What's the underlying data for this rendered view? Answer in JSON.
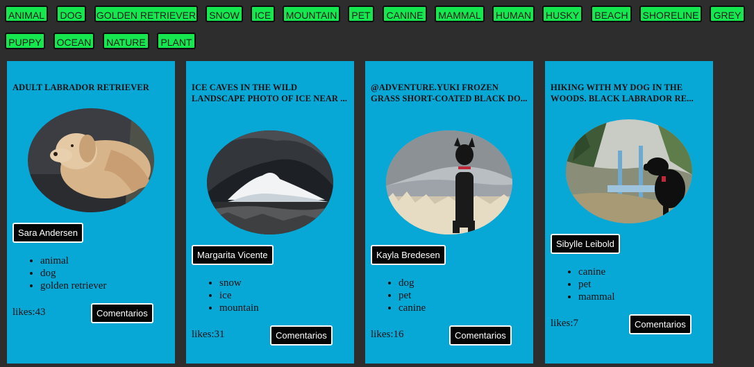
{
  "tags": [
    "ANIMAL",
    "DOG",
    "GOLDEN RETRIEVER",
    "SNOW",
    "ICE",
    "MOUNTAIN",
    "PET",
    "CANINE",
    "MAMMAL",
    "HUMAN",
    "HUSKY",
    "BEACH",
    "SHORELINE",
    "GREY",
    "PUPPY",
    "OCEAN",
    "NATURE",
    "PLANT"
  ],
  "cards": [
    {
      "title": "ADULT LABRADOR RETRIEVER",
      "author": "Sara Andersen",
      "tags": [
        "animal",
        "dog",
        "golden retriever"
      ],
      "likes": "likes:43",
      "comments_label": "Comentarios"
    },
    {
      "title": "ICE CAVES IN THE WILD LANDSCAPE PHOTO OF ICE NEAR ...",
      "author": "Margarita Vicente",
      "tags": [
        "snow",
        "ice",
        "mountain"
      ],
      "likes": "likes:31",
      "comments_label": "Comentarios"
    },
    {
      "title": "@ADVENTURE.YUKI FROZEN GRASS SHORT-COATED BLACK DO...",
      "author": "Kayla Bredesen",
      "tags": [
        "dog",
        "pet",
        "canine"
      ],
      "likes": "likes:16",
      "comments_label": "Comentarios"
    },
    {
      "title": "HIKING WITH MY DOG IN THE WOODS. BLACK LABRADOR RE...",
      "author": "Sibylle Leibold",
      "tags": [
        "canine",
        "pet",
        "mammal"
      ],
      "likes": "likes:7",
      "comments_label": "Comentarios"
    }
  ],
  "colors": {
    "background": "#2d2d2d",
    "tag_bg": "#14e84e",
    "card_bg": "#07a7d6",
    "button_bg": "#050505"
  }
}
